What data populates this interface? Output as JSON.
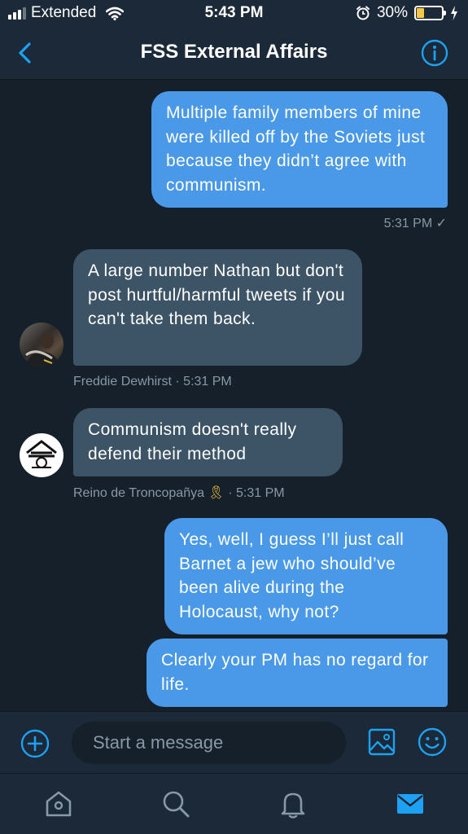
{
  "status_bar": {
    "carrier": "Extended",
    "time": "5:43 PM",
    "battery_percent": "30%",
    "battery_level": 0.3,
    "battery_color": "#f6c744"
  },
  "header": {
    "title": "FSS External Affairs",
    "back_icon": "chevron-left-icon",
    "info_icon": "info-icon"
  },
  "messages": [
    {
      "direction": "outgoing",
      "text": "Multiple family members of mine were killed off by the Soviets just because they didn’t agree with communism.",
      "time": "5:31 PM ✓"
    },
    {
      "direction": "incoming",
      "text": "A large number Nathan but don't post hurtful/harmful tweets if you can't take them back.",
      "sender": "Freddie Dewhirst",
      "time": "5:31 PM"
    },
    {
      "direction": "incoming",
      "text": "Communism doesn't really defend their method",
      "sender": "Reino de Troncopañya",
      "sender_emoji": "🎗",
      "time": "5:31 PM"
    },
    {
      "direction": "outgoing",
      "text": "Yes, well, I guess I’ll just call Barnet a jew who should’ve been alive during the Holocaust, why not?"
    },
    {
      "direction": "outgoing",
      "text": "Clearly your PM has no regard for life."
    }
  ],
  "composer": {
    "placeholder": "Start a message",
    "value": ""
  },
  "tabs": [
    {
      "name": "home",
      "icon": "home-icon"
    },
    {
      "name": "search",
      "icon": "search-icon"
    },
    {
      "name": "notifications",
      "icon": "bell-icon"
    },
    {
      "name": "messages",
      "icon": "mail-icon",
      "active": true
    }
  ],
  "colors": {
    "background": "#15202b",
    "bar": "#1c2938",
    "accent": "#1da1f2",
    "outgoing_bubble": "#4a99e9",
    "incoming_bubble": "#3d5466",
    "muted_text": "#8899a6"
  }
}
